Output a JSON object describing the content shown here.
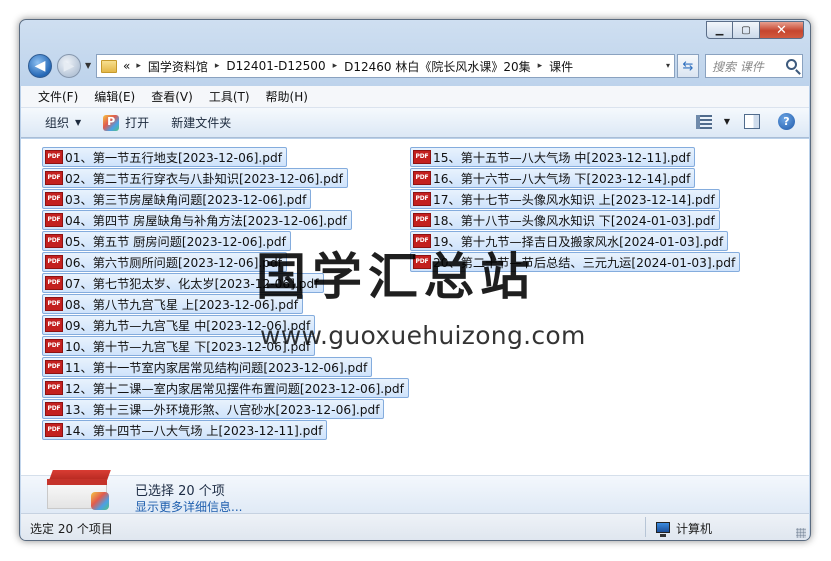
{
  "window": {
    "controls": {
      "min_glyph": "▁",
      "max_glyph": "▢",
      "close_glyph": "✕"
    }
  },
  "address": {
    "overflow": "«",
    "segments": [
      "国学资料馆",
      "D12401-D12500",
      "D12460 林白《院长风水课》20集",
      "课件"
    ],
    "separator": "▸",
    "dropdown": "▾"
  },
  "search": {
    "placeholder": "搜索 课件"
  },
  "menu": [
    "文件(F)",
    "编辑(E)",
    "查看(V)",
    "工具(T)",
    "帮助(H)"
  ],
  "toolbar": {
    "organize": "组织",
    "open": "打开",
    "new_folder": "新建文件夹",
    "help": "?"
  },
  "file_icon_text": "PDF",
  "files_left": [
    "01、第一节五行地支[2023-12-06].pdf",
    "02、第二节五行穿衣与八卦知识[2023-12-06].pdf",
    "03、第三节房屋缺角问题[2023-12-06].pdf",
    "04、第四节 房屋缺角与补角方法[2023-12-06].pdf",
    "05、第五节 厨房问题[2023-12-06].pdf",
    "06、第六节厕所问题[2023-12-06].pdf",
    "07、第七节犯太岁、化太岁[2023-12-06].pdf",
    "08、第八节九宫飞星 上[2023-12-06].pdf",
    "09、第九节—九宫飞星 中[2023-12-06].pdf",
    "10、第十节—九宫飞星 下[2023-12-06].pdf",
    "11、第十一节室内家居常见结构问题[2023-12-06].pdf",
    "12、第十二课—室内家居常见摆件布置问题[2023-12-06].pdf",
    "13、第十三课—外环境形煞、八宫砂水[2023-12-06].pdf",
    "14、第十四节—八大气场 上[2023-12-11].pdf"
  ],
  "files_right": [
    "15、第十五节—八大气场 中[2023-12-11].pdf",
    "16、第十六节—八大气场 下[2023-12-14].pdf",
    "17、第十七节—头像风水知识 上[2023-12-14].pdf",
    "18、第十八节—头像风水知识 下[2024-01-03].pdf",
    "19、第十九节—择吉日及搬家风水[2024-01-03].pdf",
    "20、第二十节—节后总结、三元九运[2024-01-03].pdf"
  ],
  "watermark": {
    "cn": "国学汇总站",
    "url": "www.guoxuehuizong.com"
  },
  "details": {
    "title": "已选择 20 个项",
    "link": "显示更多详细信息..."
  },
  "status": {
    "text": "选定 20 个项目",
    "location": "计算机"
  }
}
